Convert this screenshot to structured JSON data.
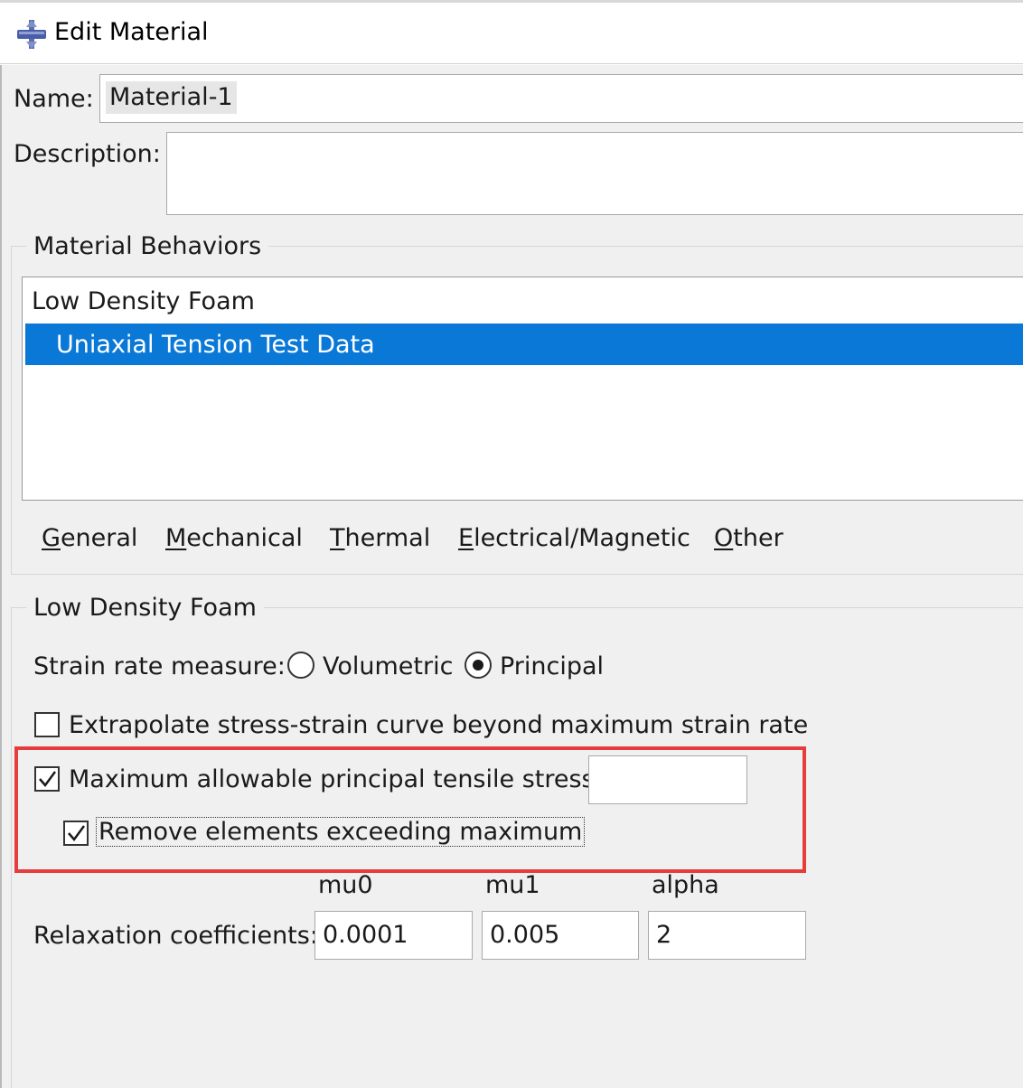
{
  "window": {
    "title": "Edit Material",
    "icon": "material-app-icon"
  },
  "form": {
    "name_label": "Name:",
    "name_value": "Material-1",
    "description_label": "Description:",
    "description_value": ""
  },
  "behaviors": {
    "group_title": "Material Behaviors",
    "items": [
      "Low Density Foam",
      "Uniaxial Tension Test Data"
    ],
    "selected_index": 1,
    "menu": [
      "General",
      "Mechanical",
      "Thermal",
      "Electrical/Magnetic",
      "Other"
    ],
    "menu_mnemonics": [
      "G",
      "M",
      "T",
      "E",
      "O"
    ]
  },
  "foam": {
    "group_title": "Low Density Foam",
    "strain_rate_label": "Strain rate measure:",
    "strain_rate_options": [
      "Volumetric",
      "Principal"
    ],
    "strain_rate_selected": "Principal",
    "extrapolate_label": "Extrapolate stress-strain curve beyond maximum strain rate",
    "extrapolate_checked": false,
    "max_stress_label": "Maximum allowable principal tensile stress:",
    "max_stress_checked": true,
    "max_stress_value": "",
    "remove_label": "Remove elements exceeding maximum",
    "remove_checked": true,
    "relax_label": "Relaxation coefficients:",
    "relax_headers": [
      "mu0",
      "mu1",
      "alpha"
    ],
    "relax_values": [
      "0.0001",
      "0.005",
      "2"
    ]
  },
  "colors": {
    "selection": "#0a78d7",
    "highlight": "#e63c3c",
    "dialog_bg": "#f0f0f0"
  }
}
